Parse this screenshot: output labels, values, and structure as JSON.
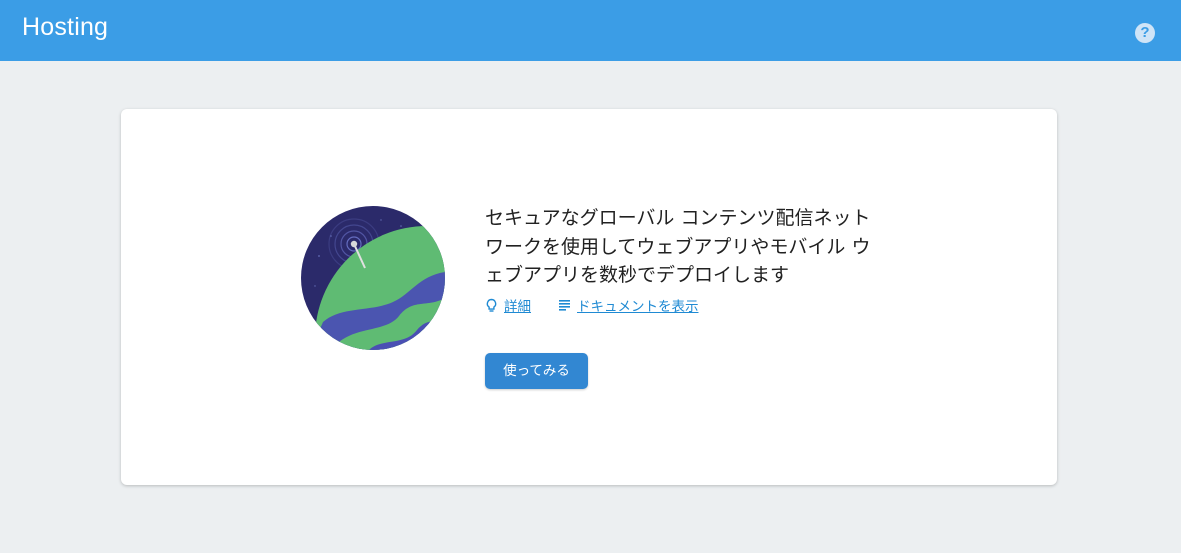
{
  "header": {
    "title": "Hosting",
    "help_icon": "help-circle-icon",
    "help_glyph": "?",
    "background": "#3b9de6"
  },
  "hosting_intro": {
    "illustration": "globe-satellite-illustration",
    "headline": "セキュアなグローバル コンテンツ配信ネットワークを使用してウェブアプリやモバイル ウェブアプリを数秒でデプロイします",
    "links": [
      {
        "icon": "lightbulb-icon",
        "label": "詳細"
      },
      {
        "icon": "document-lines-icon",
        "label": "ドキュメントを表示"
      }
    ],
    "cta_label": "使ってみる",
    "accent": "#3287d2"
  }
}
